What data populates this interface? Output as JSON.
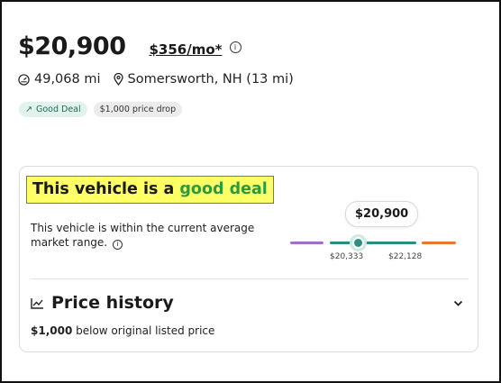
{
  "listing": {
    "price": "$20,900",
    "monthly": "$356/mo*",
    "info_glyph": "i",
    "mileage": "49,068 mi",
    "location": "Somersworth, NH (13 mi)"
  },
  "badges": {
    "good_deal_arrow": "↗",
    "good_deal": "Good Deal",
    "price_drop": "$1,000 price drop"
  },
  "deal": {
    "title_prefix": "This vehicle is a ",
    "title_highlight": "good deal",
    "description": "This vehicle is within the current average market range.",
    "current_price": "$20,900",
    "range_low": "$20,333",
    "range_high": "$22,128"
  },
  "price_history": {
    "title": "Price history",
    "amount": "$1,000",
    "note": " below original listed price"
  },
  "colors": {
    "highlight_bg": "#ffff66",
    "good_green": "#2e9a3e",
    "teal": "#2a8f7d",
    "purple": "#a56cc9",
    "orange": "#e9782e"
  },
  "icons": [
    "speedometer-icon",
    "location-pin-icon",
    "info-icon",
    "trend-arrow-icon",
    "line-chart-icon",
    "chevron-down-icon"
  ]
}
